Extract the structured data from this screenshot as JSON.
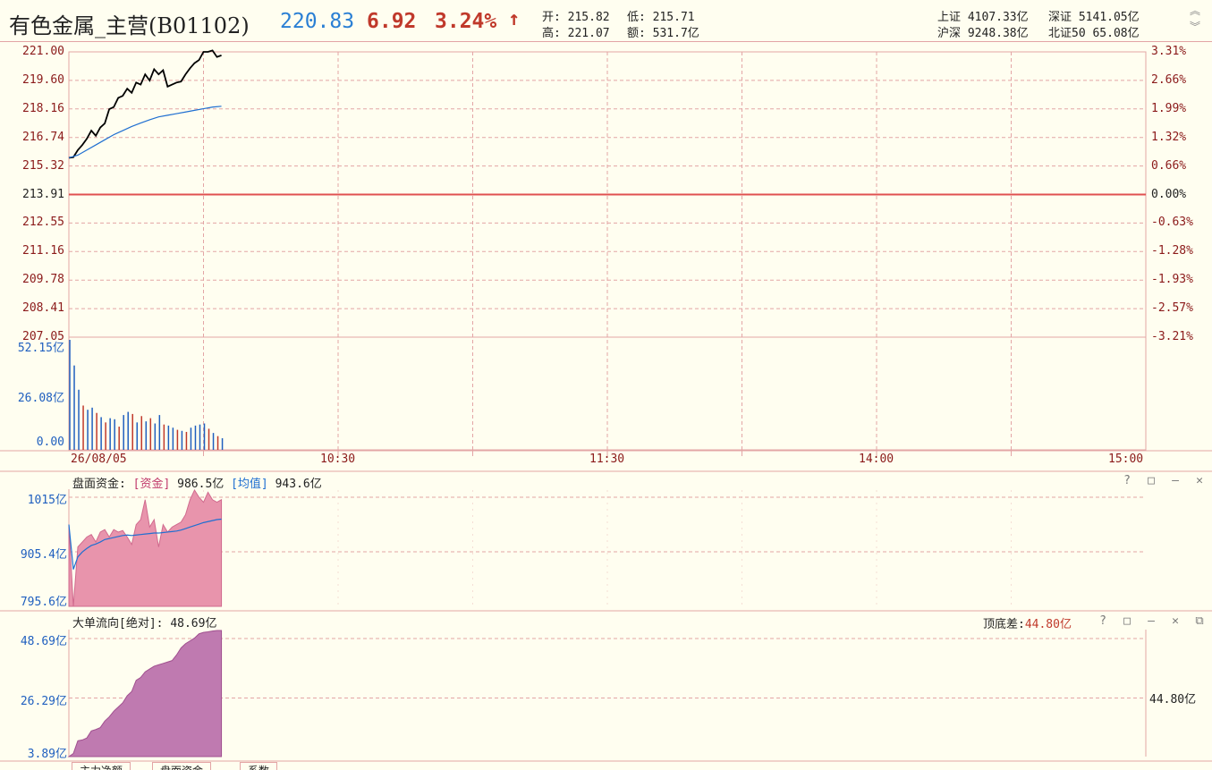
{
  "header": {
    "title": "有色金属_主营(B01102)",
    "price": "220.83",
    "change": "6.92",
    "change_pct": "3.24%",
    "arrow": "↑",
    "open_label": "开:",
    "open": "215.82",
    "high_label": "高:",
    "high": "221.07",
    "low_label": "低:",
    "low": "215.71",
    "amount_label": "额:",
    "amount": "531.7亿",
    "index1_label": "上证",
    "index1": "4107.33亿",
    "index2_label": "深证",
    "index2": "5141.05亿",
    "index3_label": "沪深",
    "index3": "9248.38亿",
    "index4_label": "北证50",
    "index4": "65.08亿"
  },
  "colors": {
    "background": "#fffef0",
    "grid": "#e3a5a5",
    "price_line": "#000000",
    "avg_line": "#1f6fd1",
    "zero_line": "#e05050",
    "volume_up": "#1f5fbf",
    "volume_down": "#c0392b",
    "fund_fill": "#e894ac",
    "fund_avg": "#1f6fd1",
    "bigorder_fill": "#bf7ab0"
  },
  "x_labels": [
    "26/08/05",
    "10:30",
    "11:30",
    "14:00",
    "15:00"
  ],
  "chart_data": [
    {
      "type": "line",
      "name": "price-chart",
      "ylim": [
        207.05,
        221.0
      ],
      "yticks_left": [
        "221.00",
        "219.60",
        "218.16",
        "216.74",
        "215.32",
        "213.91",
        "212.55",
        "211.16",
        "209.78",
        "208.41",
        "207.05"
      ],
      "yticks_right": [
        "3.31%",
        "2.66%",
        "1.99%",
        "1.32%",
        "0.66%",
        "0.00%",
        "-0.63%",
        "-1.28%",
        "-1.93%",
        "-2.57%",
        "-3.21%"
      ],
      "baseline": 213.91,
      "total_minutes": 240,
      "series": [
        {
          "x": [
            0,
            1,
            2,
            3,
            4,
            5,
            6,
            7,
            8,
            9,
            10,
            11,
            12,
            13,
            14,
            15,
            16,
            17,
            18,
            19,
            20,
            21,
            22,
            23,
            24,
            25,
            26,
            27,
            28,
            29,
            30,
            31,
            32,
            33,
            34
          ],
          "values": [
            215.82,
            215.85,
            216.2,
            216.45,
            216.75,
            217.15,
            216.9,
            217.3,
            217.5,
            218.2,
            218.3,
            218.75,
            218.85,
            219.2,
            219.0,
            219.5,
            219.4,
            219.9,
            219.6,
            220.15,
            219.9,
            220.1,
            219.3,
            219.4,
            219.5,
            219.55,
            219.9,
            220.2,
            220.45,
            220.6,
            221.0,
            221.0,
            221.07,
            220.75,
            220.83
          ]
        },
        {
          "x": [
            0,
            2,
            4,
            6,
            8,
            10,
            12,
            14,
            16,
            18,
            20,
            22,
            24,
            26,
            28,
            30,
            32,
            34
          ],
          "values": [
            215.82,
            215.95,
            216.2,
            216.45,
            216.7,
            216.95,
            217.15,
            217.35,
            217.52,
            217.68,
            217.82,
            217.9,
            217.98,
            218.06,
            218.14,
            218.22,
            218.3,
            218.34
          ]
        }
      ]
    },
    {
      "type": "bar",
      "name": "volume-chart",
      "yticks": [
        "52.15亿",
        "26.08亿",
        "0.00"
      ],
      "ylim": [
        0,
        52.15
      ],
      "x": [
        0,
        1,
        2,
        3,
        4,
        5,
        6,
        7,
        8,
        9,
        10,
        11,
        12,
        13,
        14,
        15,
        16,
        17,
        18,
        19,
        20,
        21,
        22,
        23,
        24,
        25,
        26,
        27,
        28,
        29,
        30,
        31,
        32,
        33,
        34
      ],
      "values": [
        52.15,
        40.0,
        28.5,
        21.0,
        19.0,
        20.0,
        17.5,
        15.5,
        13.0,
        15.0,
        14.5,
        11.0,
        16.5,
        18.0,
        17.0,
        13.0,
        16.0,
        13.5,
        15.0,
        12.5,
        16.5,
        12.0,
        11.5,
        10.5,
        9.5,
        9.0,
        8.5,
        10.5,
        11.5,
        12.0,
        12.5,
        10.0,
        8.0,
        6.5,
        5.5
      ],
      "up": [
        1,
        1,
        1,
        0,
        1,
        1,
        0,
        1,
        0,
        1,
        1,
        0,
        1,
        1,
        0,
        1,
        0,
        1,
        0,
        1,
        1,
        0,
        1,
        1,
        0,
        1,
        0,
        1,
        1,
        1,
        1,
        0,
        1,
        0,
        1
      ]
    },
    {
      "type": "area",
      "name": "fund-chart",
      "title": "盘面资金:",
      "series_label": "[资金]",
      "series_value": "986.5亿",
      "avg_label": "[均值]",
      "avg_value": "943.6亿",
      "yticks": [
        "1015亿",
        "905.4亿",
        "795.6亿"
      ],
      "ylim": [
        795.6,
        1015
      ],
      "x": [
        0,
        1,
        2,
        3,
        4,
        5,
        6,
        7,
        8,
        9,
        10,
        11,
        12,
        13,
        14,
        15,
        16,
        17,
        18,
        19,
        20,
        21,
        22,
        23,
        24,
        25,
        26,
        27,
        28,
        29,
        30,
        31,
        32,
        33,
        34
      ],
      "values": [
        960,
        790,
        915,
        925,
        935,
        940,
        925,
        945,
        950,
        935,
        950,
        945,
        948,
        935,
        920,
        960,
        970,
        1010,
        955,
        970,
        915,
        960,
        945,
        955,
        960,
        965,
        980,
        1010,
        1035,
        1015,
        1005,
        1025,
        1010,
        1005,
        1010
      ],
      "avg_values": [
        960,
        870,
        895,
        905,
        912,
        918,
        921,
        925,
        930,
        932,
        934,
        936,
        938,
        939,
        938,
        939,
        940,
        941,
        942,
        943,
        943,
        944,
        945,
        946,
        947,
        949,
        952,
        955,
        958,
        961,
        964,
        966,
        968,
        970,
        971
      ]
    },
    {
      "type": "area",
      "name": "bigorder-chart",
      "title": "大单流向[绝对]:",
      "value": "48.69亿",
      "diff_label": "顶底差:",
      "diff_value": "44.80亿",
      "right_label": "44.80亿",
      "yticks": [
        "48.69亿",
        "26.29亿",
        "3.89亿"
      ],
      "ylim": [
        3.89,
        48.69
      ],
      "x": [
        0,
        1,
        2,
        3,
        4,
        5,
        6,
        7,
        8,
        9,
        10,
        11,
        12,
        13,
        14,
        15,
        16,
        17,
        18,
        19,
        20,
        21,
        22,
        23,
        24,
        25,
        26,
        27,
        28,
        29,
        30,
        31,
        32,
        33,
        34
      ],
      "values": [
        3.89,
        5.0,
        9.5,
        9.8,
        10.5,
        13.0,
        13.5,
        14.2,
        16.5,
        18.0,
        20.0,
        21.5,
        23.0,
        25.5,
        27.0,
        31.0,
        32.0,
        34.0,
        35.0,
        36.0,
        36.5,
        37.0,
        37.5,
        38.0,
        40.0,
        42.5,
        44.0,
        45.0,
        46.0,
        47.5,
        48.0,
        48.2,
        48.5,
        48.69,
        48.69
      ]
    }
  ],
  "panel_controls": [
    "?",
    "□",
    "—",
    "✕"
  ],
  "panel_controls_extra": "⧉",
  "tabs": [
    "主力净额",
    "盘面资金",
    "系数"
  ]
}
